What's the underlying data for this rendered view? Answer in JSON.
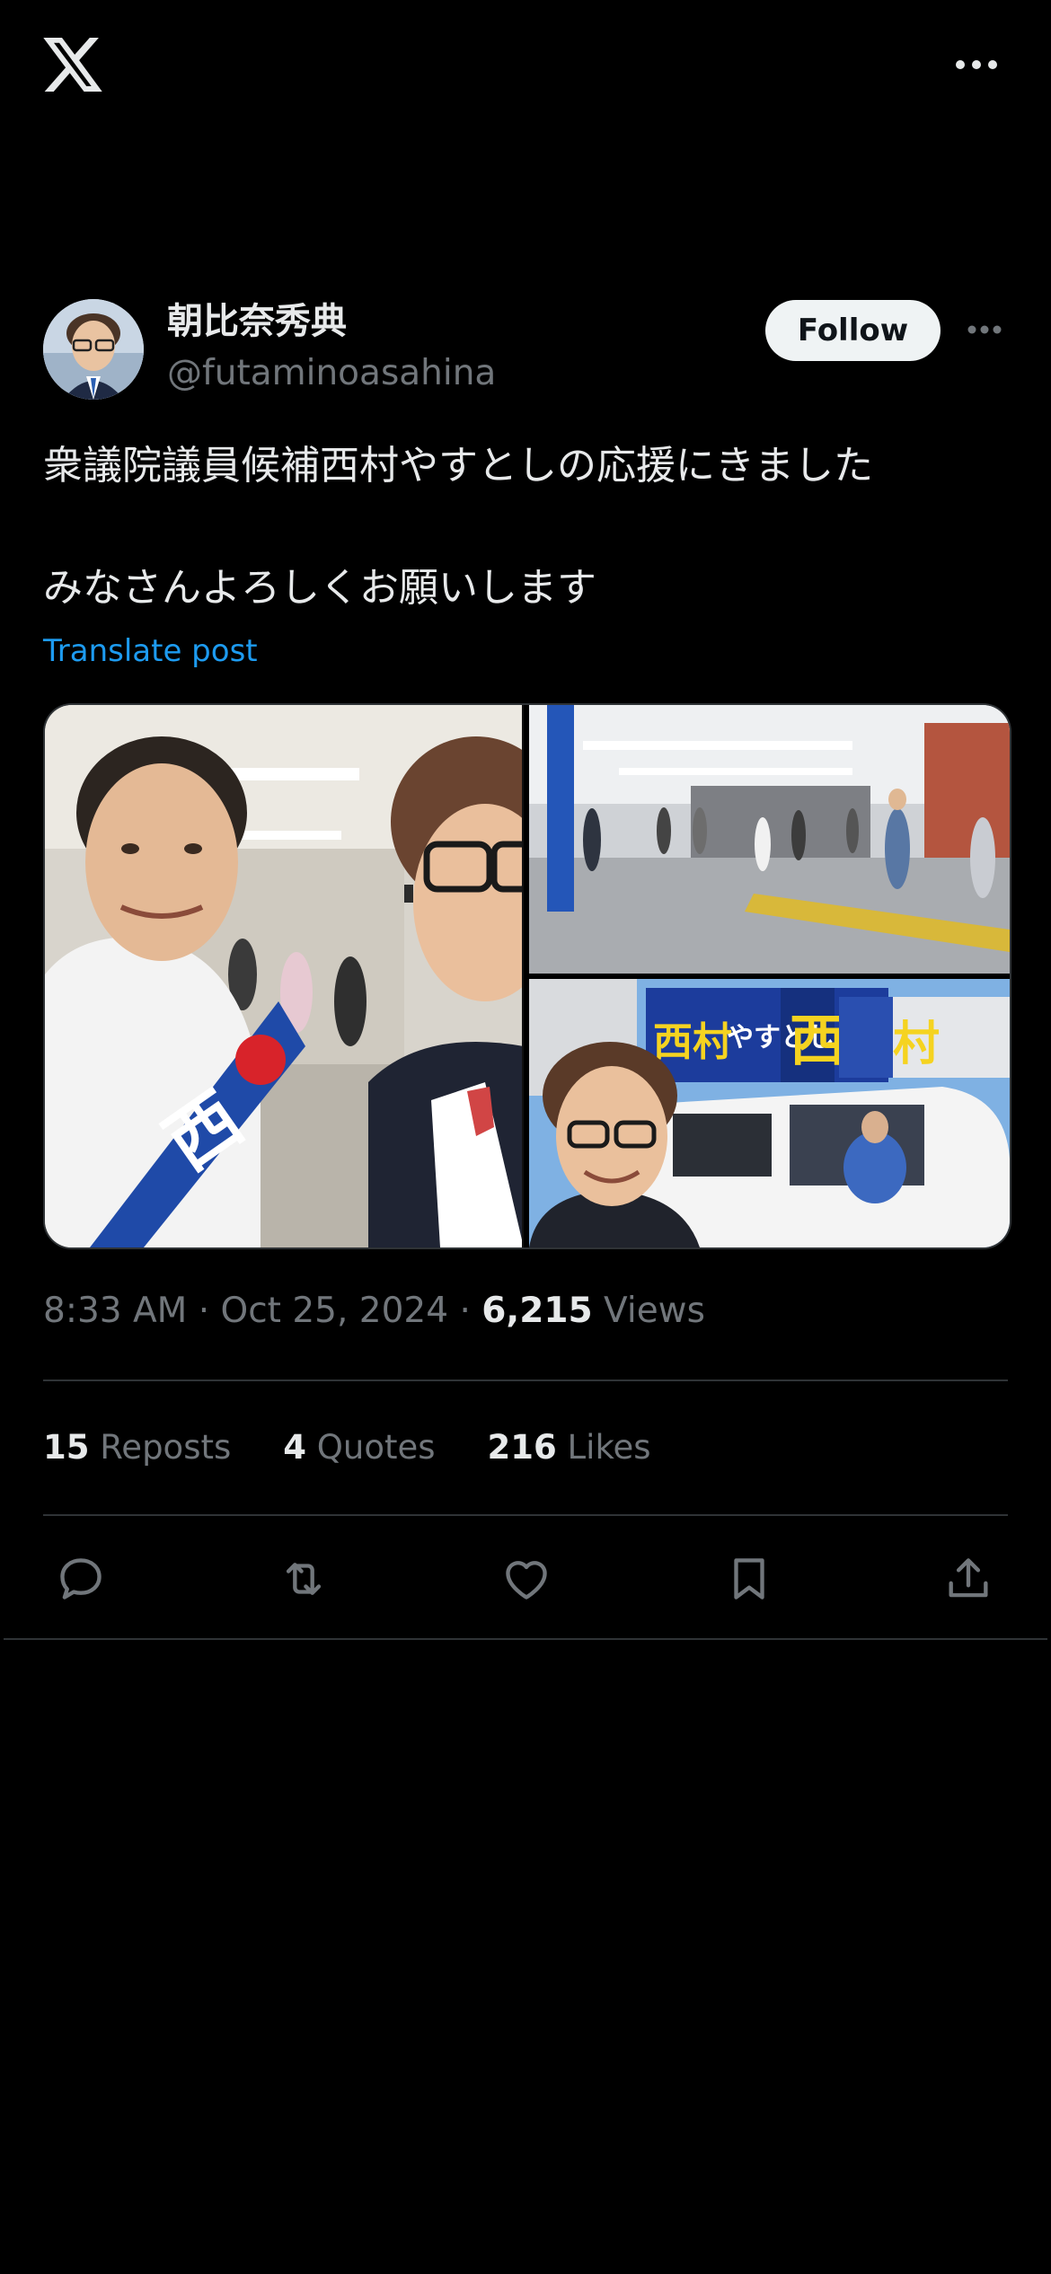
{
  "post": {
    "author": {
      "display_name": "朝比奈秀典",
      "handle": "@futaminoasahina"
    },
    "follow_label": "Follow",
    "text": "衆議院議員候補西村やすとしの応援にきました\n\nみなさんよろしくお願いします",
    "translate_label": "Translate post",
    "meta": {
      "time": "8:33 AM",
      "date": "Oct 25, 2024",
      "views_count": "6,215",
      "views_label": "Views",
      "separator": "·"
    },
    "stats": [
      {
        "count": "15",
        "label": "Reposts"
      },
      {
        "count": "4",
        "label": "Quotes"
      },
      {
        "count": "216",
        "label": "Likes"
      }
    ],
    "media": {
      "sign_text_1": "西村",
      "sign_text_2": "やすとし",
      "sign_text_3": "西",
      "sign_text_4": "村",
      "sash_text": "西"
    },
    "icons": {
      "logo": "x-logo-icon",
      "more": "more-icon",
      "reply": "reply-icon",
      "repost": "repost-icon",
      "like": "like-icon",
      "bookmark": "bookmark-icon",
      "share": "share-icon"
    }
  },
  "colors": {
    "background": "#000000",
    "text_primary": "#e7e9ea",
    "text_secondary": "#71767b",
    "link": "#1d9bf0",
    "divider": "#2f3336",
    "follow_bg": "#eff3f4"
  }
}
